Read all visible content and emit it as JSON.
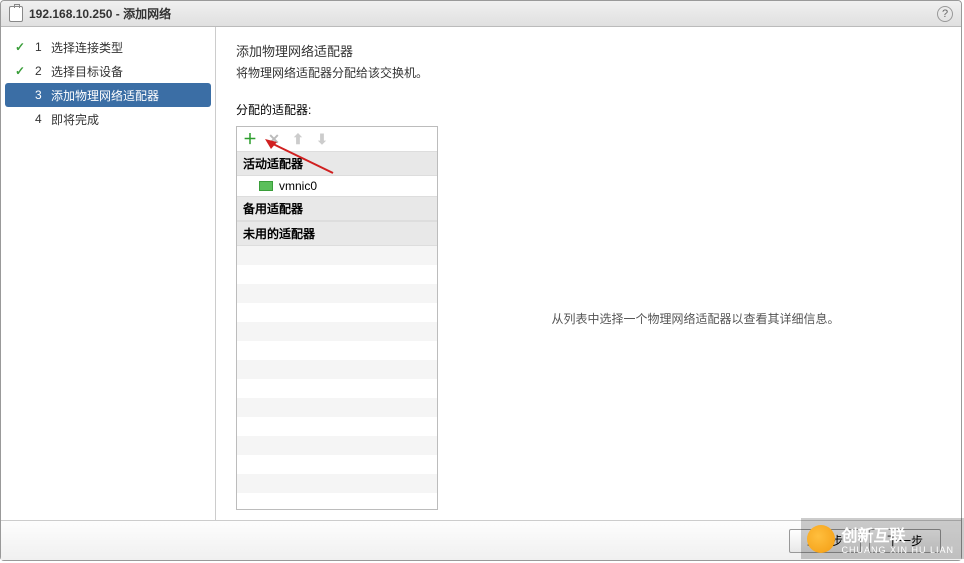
{
  "window": {
    "title": "192.168.10.250 - 添加网络"
  },
  "steps": [
    {
      "num": "1",
      "label": "选择连接类型",
      "done": true,
      "active": false
    },
    {
      "num": "2",
      "label": "选择目标设备",
      "done": true,
      "active": false
    },
    {
      "num": "3",
      "label": "添加物理网络适配器",
      "done": false,
      "active": true
    },
    {
      "num": "4",
      "label": "即将完成",
      "done": false,
      "active": false
    }
  ],
  "main": {
    "title": "添加物理网络适配器",
    "subtitle": "将物理网络适配器分配给该交换机。",
    "section_label": "分配的适配器:"
  },
  "adapter_groups": {
    "active_label": "活动适配器",
    "standby_label": "备用适配器",
    "unused_label": "未用的适配器",
    "active_items": [
      {
        "name": "vmnic0"
      }
    ]
  },
  "detail_placeholder": "从列表中选择一个物理网络适配器以查看其详细信息。",
  "buttons": {
    "back": "上一步",
    "next": "下一步"
  },
  "watermark": {
    "brand": "创新互联",
    "sub": "CHUANG XIN HU LIAN"
  }
}
